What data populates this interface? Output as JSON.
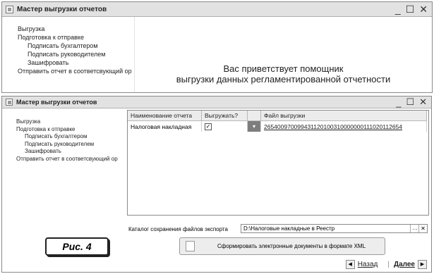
{
  "back_window": {
    "title": "Мастер выгрузки отчетов",
    "steps": [
      "Выгрузка",
      "Подготовка к отправке",
      "Подписать бухгалтером",
      "Подписать руководителем",
      "Зашифровать",
      "Отправить отчет в соответсвующий ор"
    ],
    "welcome_line1": "Вас приветствует помощник",
    "welcome_line2": "выгрузки данных регламентированной отчетности"
  },
  "front_window": {
    "title": "Мастер выгрузки отчетов",
    "steps": [
      "Выгрузка",
      "Подготовка к отправке",
      "Подписать бухгалтером",
      "Подписать руководителем",
      "Зашифровать",
      "Отправить отчет в соответсвующий ор"
    ],
    "table": {
      "columns": [
        "Наименование отчета",
        "Выгружать?",
        "",
        "Файл выгрузки"
      ],
      "rows": [
        {
          "name": "Налоговая накладная",
          "checked": true,
          "checkmark": "✓",
          "file": "2654009700994311201003100000001110201126​54"
        }
      ]
    },
    "catalog_label": "Каталог сохранения файлов экспорта",
    "catalog_value": "D:\\Налоговые накладные в Реестр",
    "generate_button": "Сформировать электронные документы в формате XML",
    "back_button": "Назад",
    "next_button": "Далее",
    "figure_label": "Рис. 4"
  }
}
